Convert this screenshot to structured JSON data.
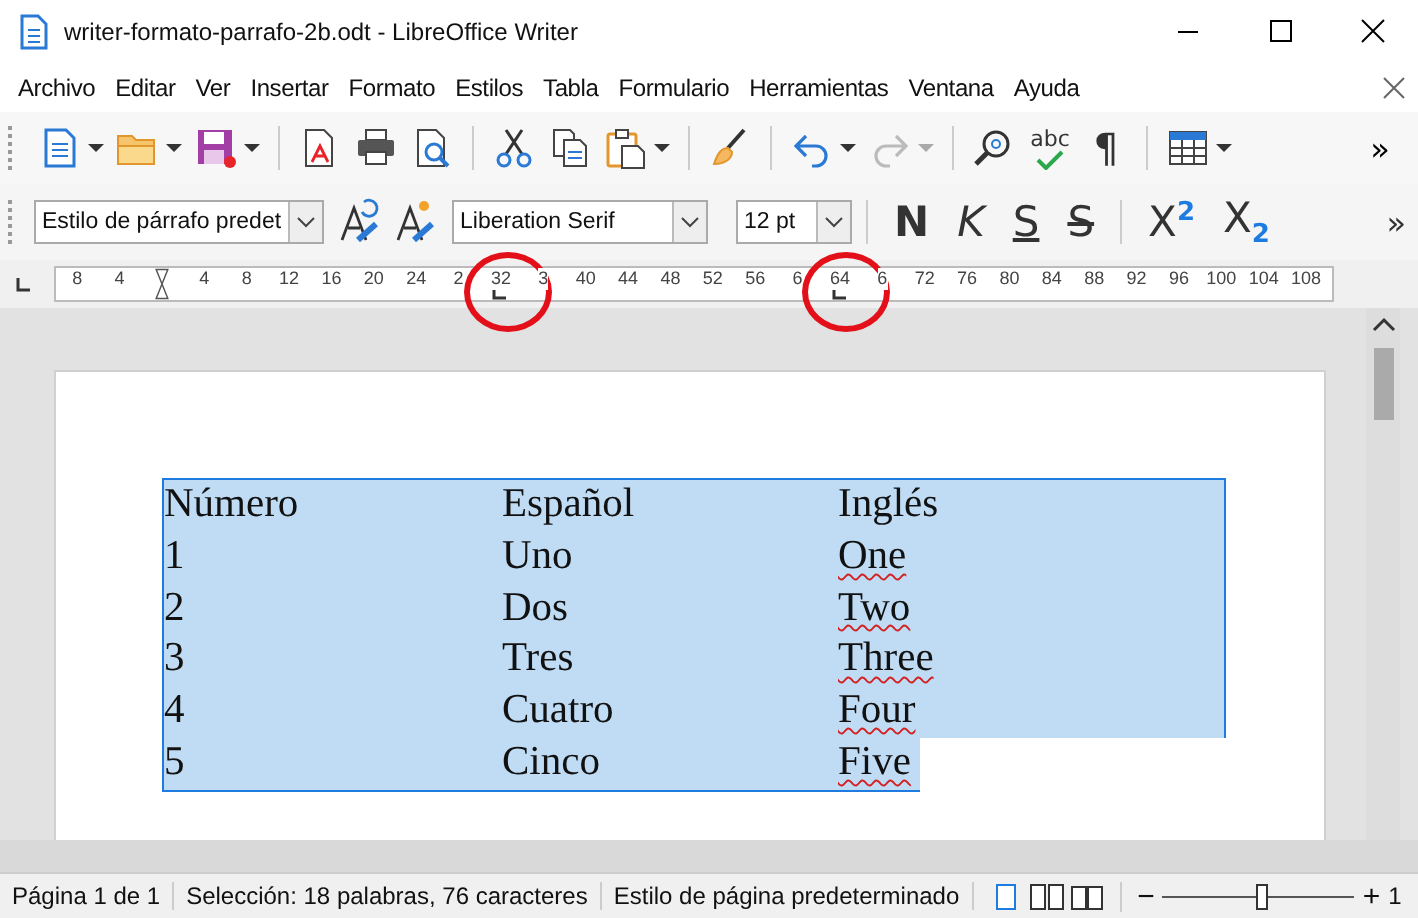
{
  "window": {
    "title": "writer-formato-parrafo-2b.odt - LibreOffice Writer"
  },
  "menu": [
    "Archivo",
    "Editar",
    "Ver",
    "Insertar",
    "Formato",
    "Estilos",
    "Tabla",
    "Formulario",
    "Herramientas",
    "Ventana",
    "Ayuda"
  ],
  "standard_toolbar": [
    {
      "kind": "new",
      "dropdown": true
    },
    {
      "kind": "open",
      "dropdown": true
    },
    {
      "kind": "save",
      "dropdown": true
    },
    {
      "kind": "separator"
    },
    {
      "kind": "pdf"
    },
    {
      "kind": "print"
    },
    {
      "kind": "preview"
    },
    {
      "kind": "separator"
    },
    {
      "kind": "cut"
    },
    {
      "kind": "copy"
    },
    {
      "kind": "paste",
      "dropdown": true
    },
    {
      "kind": "separator"
    },
    {
      "kind": "clone"
    },
    {
      "kind": "separator"
    },
    {
      "kind": "undo",
      "dropdown": true,
      "disabled": false
    },
    {
      "kind": "redo",
      "dropdown": true,
      "disabled": true
    },
    {
      "kind": "separator"
    },
    {
      "kind": "find"
    },
    {
      "kind": "spell",
      "label": "abc"
    },
    {
      "kind": "char",
      "label": "¶"
    },
    {
      "kind": "separator"
    },
    {
      "kind": "table",
      "dropdown": true
    },
    {
      "kind": "more",
      "label": "»"
    }
  ],
  "formatting_toolbar": {
    "paragraph_style": "Estilo de párrafo predet",
    "font_name": "Liberation Serif",
    "font_size": "12 pt",
    "buttons": [
      {
        "kind": "bold",
        "label": "N"
      },
      {
        "kind": "italic",
        "label": "K"
      },
      {
        "kind": "underline",
        "label": "S"
      },
      {
        "kind": "strike",
        "label": "S"
      },
      {
        "kind": "separator"
      },
      {
        "kind": "script",
        "label": "X$^{2}$"
      },
      {
        "kind": "script",
        "label": "X$_{2}$"
      },
      {
        "kind": "more",
        "label": "»"
      }
    ]
  },
  "ruler": [
    {
      "text": "8"
    },
    {
      "text": "4"
    },
    {
      "kind": "indent"
    },
    {
      "text": "4"
    },
    {
      "text": "8"
    },
    {
      "text": "12"
    },
    {
      "text": "16"
    },
    {
      "text": "20"
    },
    {
      "text": "24"
    },
    {
      "text": "2"
    },
    {
      "text": "32",
      "tab": true,
      "circled": true
    },
    {
      "text": "3"
    },
    {
      "text": "40"
    },
    {
      "text": "44"
    },
    {
      "text": "48"
    },
    {
      "text": "52"
    },
    {
      "text": "56"
    },
    {
      "text": "6"
    },
    {
      "text": "64",
      "tab": true,
      "circled": true
    },
    {
      "text": "6"
    },
    {
      "text": "72"
    },
    {
      "text": "76"
    },
    {
      "text": "80"
    },
    {
      "text": "84"
    },
    {
      "text": "88"
    },
    {
      "text": "92"
    },
    {
      "text": "96"
    },
    {
      "text": "100"
    },
    {
      "text": "104"
    },
    {
      "text": "108"
    }
  ],
  "document": {
    "rows": [
      {
        "cells": [
          {
            "text": "Número"
          },
          {
            "text": "Español"
          },
          {
            "text": "Inglés"
          }
        ],
        "selected": true,
        "partial_selection": false
      },
      {
        "cells": [
          {
            "text": "1"
          },
          {
            "text": "Uno"
          },
          {
            "text": "One",
            "misspelled": true
          }
        ],
        "selected": true,
        "partial_selection": false
      },
      {
        "cells": [
          {
            "text": "2"
          },
          {
            "text": "Dos"
          },
          {
            "text": "Two",
            "misspelled": true
          }
        ],
        "selected": true,
        "partial_selection": false
      },
      {
        "cells": [
          {
            "text": "3"
          },
          {
            "text": "Tres"
          },
          {
            "text": "Three",
            "misspelled": true
          }
        ],
        "selected": true,
        "partial_selection": false
      },
      {
        "cells": [
          {
            "text": "4"
          },
          {
            "text": "Cuatro"
          },
          {
            "text": "Four",
            "misspelled": true
          }
        ],
        "selected": true,
        "partial_selection": false
      },
      {
        "cells": [
          {
            "text": "5"
          },
          {
            "text": "Cinco"
          },
          {
            "text": "Five",
            "misspelled": true
          }
        ],
        "selected": true,
        "partial_selection": true
      }
    ]
  },
  "status_bar": {
    "page": "Página 1 de 1",
    "selection": "Selección: 18 palabras, 76 caracteres",
    "page_style": "Estilo de página predeterminado",
    "views": [
      {
        "kind": "single",
        "selected": true
      },
      {
        "kind": "multi",
        "selected": false
      },
      {
        "kind": "book",
        "selected": false
      }
    ],
    "zoom": {
      "level": 0.52,
      "minus": "−",
      "plus": "+",
      "percent": "1"
    }
  }
}
